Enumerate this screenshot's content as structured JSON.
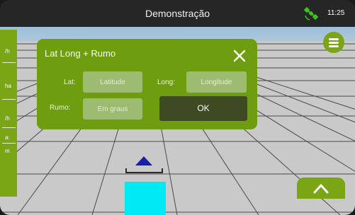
{
  "topbar": {
    "title": "Demonstração",
    "time": "11:25",
    "status_icon": "satellite-icon",
    "status_color": "#3fbf2a"
  },
  "side_panel": {
    "items": [
      "/h",
      "ha",
      "/h",
      "a:",
      "m"
    ]
  },
  "dialog": {
    "title": "Lat Long + Rumo",
    "lat_label": "Lat:",
    "lat_placeholder": "Latitude",
    "long_label": "Long:",
    "long_placeholder": "Longitude",
    "rumo_label": "Rumo:",
    "rumo_placeholder": "Em graus",
    "ok_label": "OK"
  },
  "colors": {
    "accent": "#7aa515",
    "dialog_bg": "#6e9e10",
    "ok_bg": "#3e4a22",
    "vehicle": "#00eaf5",
    "heading_arrow": "#1520a6"
  }
}
